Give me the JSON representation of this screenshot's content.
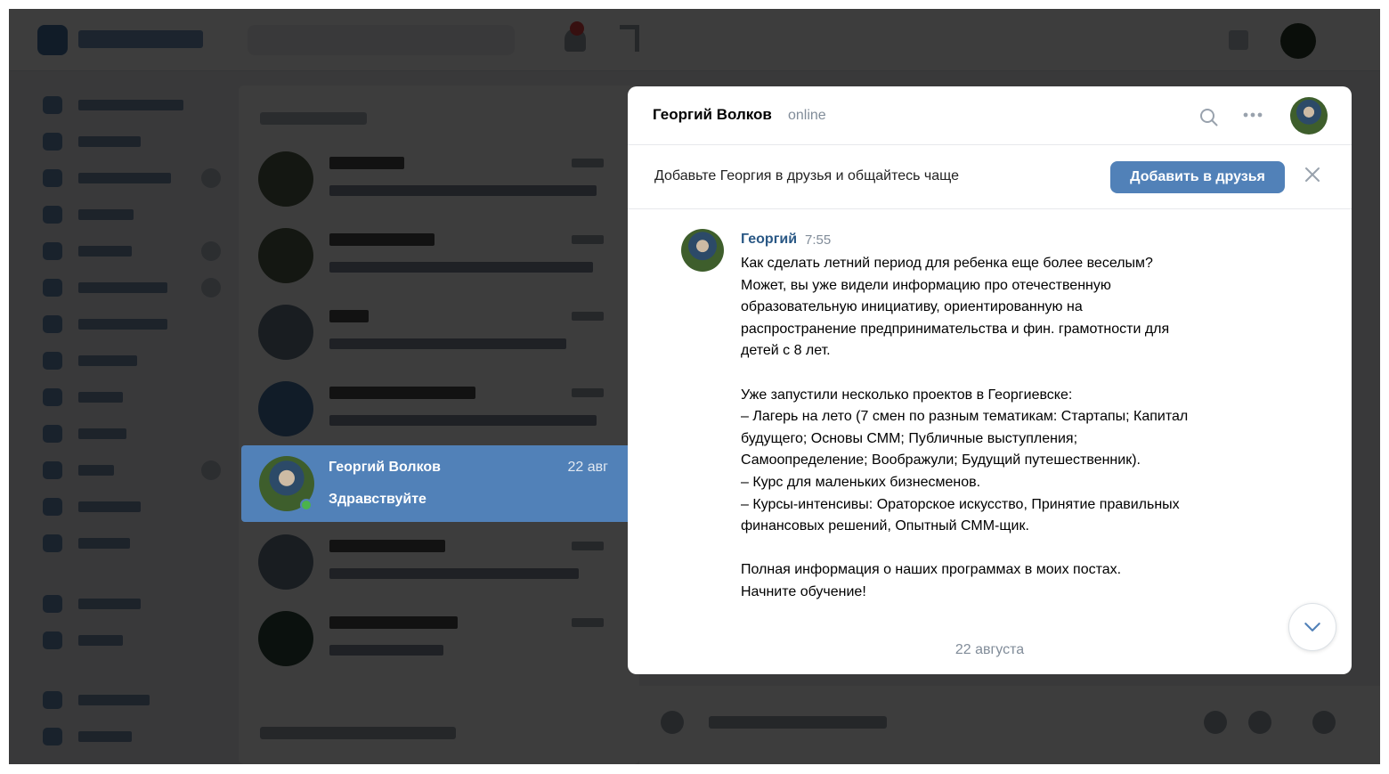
{
  "chat_header": {
    "name": "Георгий Волков",
    "status": "online"
  },
  "friend_banner": {
    "text": "Добавьте Георгия в друзья и общайтесь чаще",
    "button": "Добавить в друзья"
  },
  "message": {
    "author": "Георгий",
    "time": "7:55",
    "lines": [
      "Как сделать летний период для ребенка еще более веселым?",
      "Может, вы уже видели информацию про отечественную",
      "образовательную инициативу, ориентированную на",
      "распространение предпринимательства и фин. грамотности для",
      "детей с 8 лет.",
      "",
      "Уже запустили несколько проектов в Георгиевске:",
      "– Лагерь на лето (7 смен по разным тематикам: Стартапы; Капитал",
      "будущего; Основы СММ; Публичные выступления;",
      "Самоопределение; Воображули; Будущий путешественник).",
      "– Курс для маленьких бизнесменов.",
      "– Курсы-интенсивы: Ораторское искусство, Принятие правильных",
      "финансовых решений, Опытный СММ-щик.",
      "",
      "Полная информация о наших программах в моих постах.",
      "Начните обучение!"
    ]
  },
  "date_divider": "22 августа",
  "selected_dialog": {
    "name": "Георгий Волков",
    "time": "22 авг",
    "preview": "Здравствуйте"
  },
  "colors": {
    "accent": "#5181b8",
    "link": "#2a5885",
    "muted": "#818c99",
    "online": "#4bb34b"
  },
  "icons": [
    "search-icon",
    "more-icon",
    "close-icon",
    "chevron-down-icon"
  ]
}
